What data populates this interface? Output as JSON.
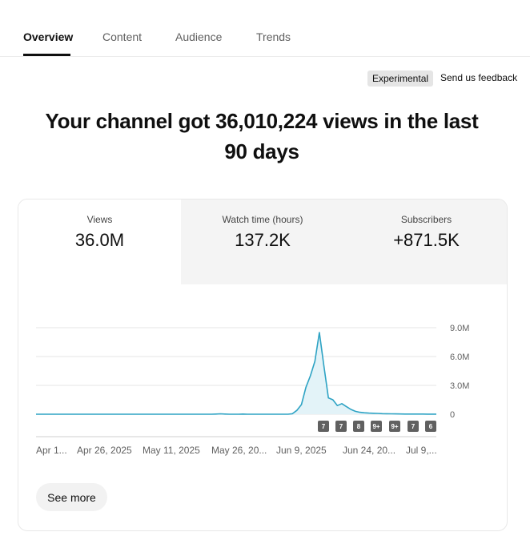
{
  "tabs": [
    {
      "label": "Overview",
      "active": true
    },
    {
      "label": "Content",
      "active": false
    },
    {
      "label": "Audience",
      "active": false
    },
    {
      "label": "Trends",
      "active": false
    }
  ],
  "experimental_badge": "Experimental",
  "feedback_link": "Send us feedback",
  "headline_line1": "Your channel got 36,010,224 views in the last",
  "headline_line2": "90 days",
  "metrics": [
    {
      "label": "Views",
      "value": "36.0M",
      "selected": true
    },
    {
      "label": "Watch time (hours)",
      "value": "137.2K",
      "selected": false
    },
    {
      "label": "Subscribers",
      "value": "+871.5K",
      "selected": false
    }
  ],
  "see_more": "See more",
  "colors": {
    "line": "#2ea3c4",
    "fill": "#e3f3f8",
    "marker": "#606060"
  },
  "chart_data": {
    "type": "line",
    "title": "",
    "xlabel": "",
    "ylabel": "",
    "ylim": [
      0,
      9000000
    ],
    "y_ticks": [
      0,
      3000000,
      6000000,
      9000000
    ],
    "y_tick_labels": [
      "0",
      "3.0M",
      "6.0M",
      "9.0M"
    ],
    "x_tick_labels": [
      "Apr 1...",
      "Apr 26, 2025",
      "May 11, 2025",
      "May 26, 20...",
      "Jun 9, 2025",
      "Jun 24, 20...",
      "Jul 9,..."
    ],
    "grid": true,
    "series": [
      {
        "values": [
          0,
          0,
          0,
          0,
          0,
          0,
          0,
          0,
          0,
          0,
          0,
          0,
          0,
          0,
          0,
          0,
          0,
          0,
          0,
          0,
          0,
          0,
          0,
          0,
          0,
          0,
          0,
          0,
          0,
          0,
          0,
          0,
          0,
          0,
          0,
          0,
          0,
          0,
          0,
          0,
          20000,
          40000,
          20000,
          0,
          0,
          0,
          20000,
          0,
          0,
          0,
          0,
          0,
          0,
          0,
          0,
          0,
          0,
          50000,
          400000,
          1000000,
          2800000,
          4000000,
          5500000,
          8500000,
          5000000,
          1700000,
          1500000,
          900000,
          1100000,
          800000,
          500000,
          300000,
          200000,
          150000,
          120000,
          100000,
          80000,
          60000,
          50000,
          40000,
          30000,
          25000,
          20000,
          20000,
          15000,
          15000,
          15000,
          10000,
          10000,
          10000
        ]
      }
    ],
    "event_markers": [
      "7",
      "7",
      "8",
      "9+",
      "9+",
      "7",
      "6"
    ]
  }
}
